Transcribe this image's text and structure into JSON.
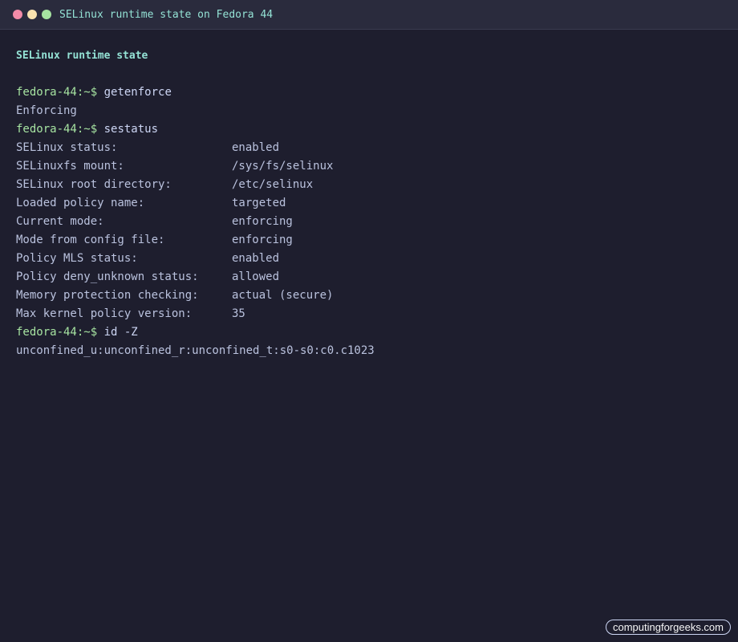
{
  "window": {
    "title": "SELinux runtime state on Fedora 44"
  },
  "colors": {
    "background": "#1e1e2e",
    "titlebar": "#2a2b3d",
    "prompt": "#a6e3a1",
    "heading": "#94e2d5",
    "close": "#f38ba8",
    "minimize": "#f9e2af",
    "maximize": "#a6e3a1"
  },
  "terminal": {
    "heading": "SELinux runtime state",
    "prompt": "fedora-44:~$",
    "cmd1": "getenforce",
    "out1": "Enforcing",
    "cmd2": "sestatus",
    "sestatus": [
      {
        "key": "SELinux status:",
        "value": "enabled"
      },
      {
        "key": "SELinuxfs mount:",
        "value": "/sys/fs/selinux"
      },
      {
        "key": "SELinux root directory:",
        "value": "/etc/selinux"
      },
      {
        "key": "Loaded policy name:",
        "value": "targeted"
      },
      {
        "key": "Current mode:",
        "value": "enforcing"
      },
      {
        "key": "Mode from config file:",
        "value": "enforcing"
      },
      {
        "key": "Policy MLS status:",
        "value": "enabled"
      },
      {
        "key": "Policy deny_unknown status:",
        "value": "allowed"
      },
      {
        "key": "Memory protection checking:",
        "value": "actual (secure)"
      },
      {
        "key": "Max kernel policy version:",
        "value": "35"
      }
    ],
    "cmd3": "id -Z",
    "out3": "unconfined_u:unconfined_r:unconfined_t:s0-s0:c0.c1023"
  },
  "watermark": "computingforgeeks.com"
}
